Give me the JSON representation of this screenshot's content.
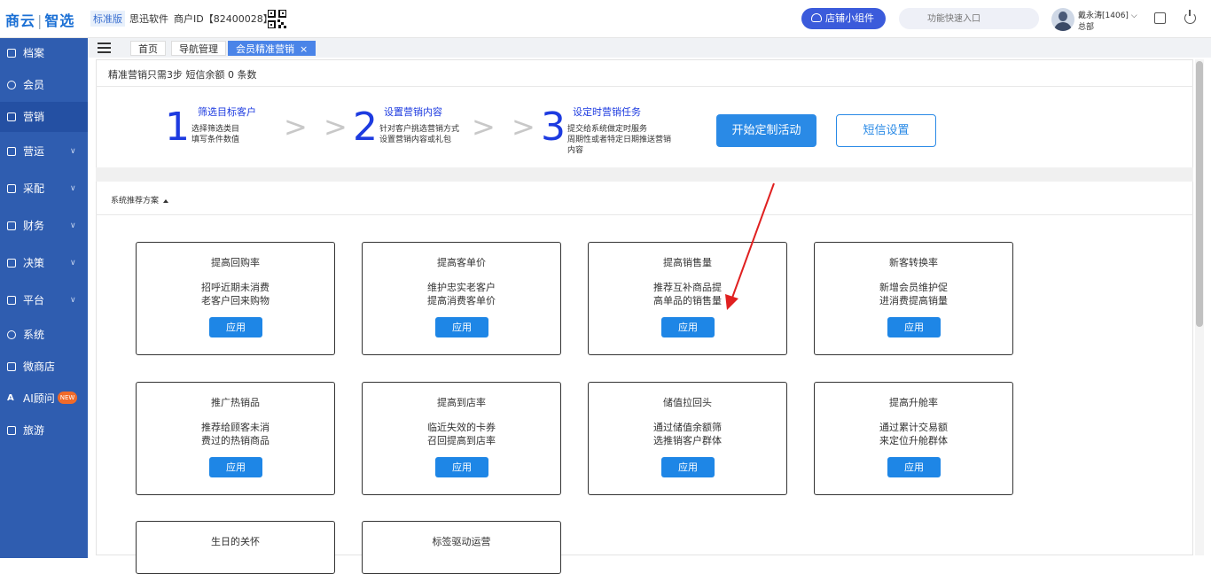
{
  "app": {
    "logo_part1": "商云",
    "logo_part2": "智选",
    "edition": "标准版",
    "company": "思迅软件",
    "merchant": "商户ID【82400028】"
  },
  "header": {
    "shop_widget_label": "店铺小组件",
    "search_placeholder": "功能快速入口",
    "user_name": "戴永涛[1406]",
    "user_dept": "总部"
  },
  "sidebar": {
    "items": [
      {
        "label": "档案",
        "icon": "file-icon",
        "has_children": false
      },
      {
        "label": "会员",
        "icon": "user-icon",
        "has_children": false
      },
      {
        "label": "营销",
        "icon": "shop-icon",
        "has_children": false,
        "active": true
      },
      {
        "label": "营运",
        "icon": "store-icon",
        "has_children": true
      },
      {
        "label": "采配",
        "icon": "purchase-icon",
        "has_children": true
      },
      {
        "label": "财务",
        "icon": "finance-icon",
        "has_children": true
      },
      {
        "label": "决策",
        "icon": "decision-icon",
        "has_children": true
      },
      {
        "label": "平台",
        "icon": "platform-icon",
        "has_children": true
      },
      {
        "label": "系统",
        "icon": "system-icon",
        "has_children": false
      },
      {
        "label": "微商店",
        "icon": "micro-shop-icon",
        "has_children": false
      },
      {
        "label": "AI顾问",
        "icon": "ai-icon",
        "has_children": false,
        "badge": "NEW"
      },
      {
        "label": "旅游",
        "icon": "travel-icon",
        "has_children": false
      }
    ]
  },
  "tabs": [
    {
      "label": "首页",
      "active": false
    },
    {
      "label": "导航管理",
      "active": false
    },
    {
      "label": "会员精准营销",
      "active": true,
      "close": "×"
    }
  ],
  "info_line": "精准营销只需3步  短信余额 0 条数",
  "steps": [
    {
      "num": "1",
      "title": "筛选目标客户",
      "desc1": "选择筛选类目",
      "desc2": "填写条件数值"
    },
    {
      "num": "2",
      "title": "设置营销内容",
      "desc1": "针对客户挑选营销方式",
      "desc2": "设置营销内容或礼包"
    },
    {
      "num": "3",
      "title": "设定时营销任务",
      "desc1": "提交给系统做定时服务",
      "desc2": "周期性或者特定日期推送营销",
      "desc3": "内容"
    }
  ],
  "step_separator": "> >",
  "buttons": {
    "start_campaign": "开始定制活动",
    "sms_settings": "短信设置"
  },
  "section_title": "系统推荐方案",
  "cards": [
    {
      "title": "提高回购率",
      "line1": "招呼近期未消费",
      "line2": "老客户回来购物",
      "button": "应用"
    },
    {
      "title": "提高客单价",
      "line1": "维护忠实老客户",
      "line2": "提高消费客单价",
      "button": "应用"
    },
    {
      "title": "提高销售量",
      "line1": "推荐互补商品提",
      "line2": "高单品的销售量",
      "button": "应用"
    },
    {
      "title": "新客转换率",
      "line1": "新增会员维护促",
      "line2": "进消费提高销量",
      "button": "应用"
    },
    {
      "title": "推广热销品",
      "line1": "推荐给顾客未消",
      "line2": "费过的热销商品",
      "button": "应用"
    },
    {
      "title": "提高到店率",
      "line1": "临近失效的卡券",
      "line2": "召回提高到店率",
      "button": "应用"
    },
    {
      "title": "储值拉回头",
      "line1": "通过储值余额筛",
      "line2": "选推销客户群体",
      "button": "应用"
    },
    {
      "title": "提高升舱率",
      "line1": "通过累计交易额",
      "line2": "来定位升舱群体",
      "button": "应用"
    },
    {
      "title": "生日的关怀",
      "line1": "",
      "line2": "",
      "button": ""
    },
    {
      "title": "标签驱动运营",
      "line1": "",
      "line2": "",
      "button": ""
    }
  ],
  "colors": {
    "sidebar_bg": "#2f5db0",
    "accent": "#2a8ae6",
    "step_blue": "#1d3be0",
    "annotation_red": "#e02020"
  }
}
